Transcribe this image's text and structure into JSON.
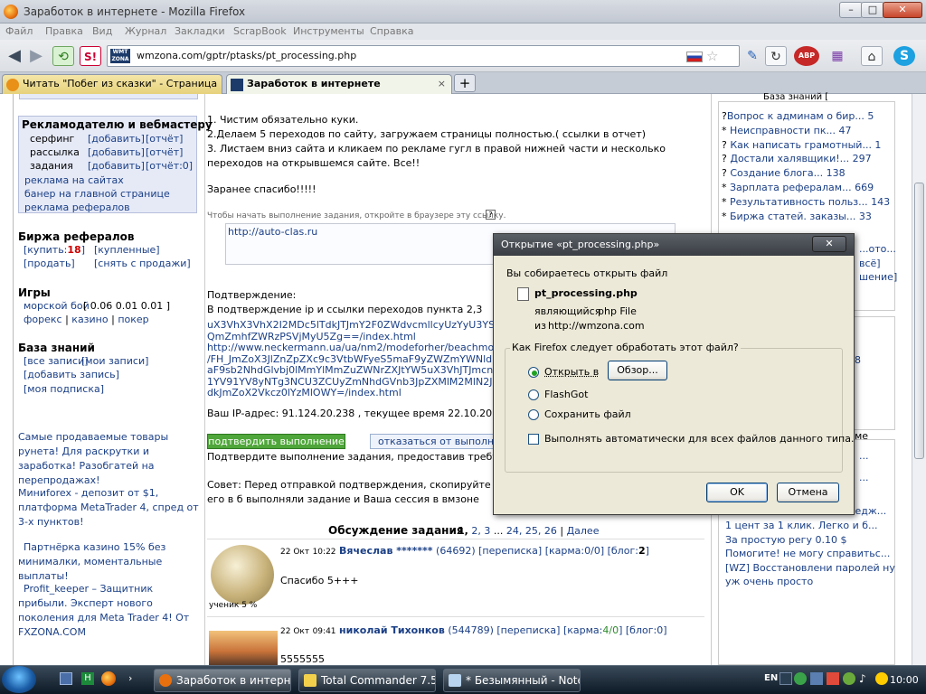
{
  "window": {
    "title": "Заработок в интернете - Mozilla Firefox",
    "minimize": "–",
    "maximize": "□",
    "close": "✕"
  },
  "menu": [
    "Файл",
    "Правка",
    "Вид",
    "Журнал",
    "Закладки",
    "ScrapBook",
    "Инструменты",
    "Справка"
  ],
  "url": "wmzona.com/gptr/ptasks/pt_processing.php",
  "tabs": [
    {
      "label": "Читать \"Побег из сказки\" - Страница 1...",
      "close": "×"
    },
    {
      "label": "Заработок в интернете",
      "close": "×"
    }
  ],
  "new_tab": "+",
  "left": {
    "ads_title": "Рекламодателю и вебмастеру",
    "rows": [
      {
        "name": "серфинг",
        "add": "[добавить]",
        "rep": "[отчёт]"
      },
      {
        "name": "рассылка",
        "add": "[добавить]",
        "rep": "[отчёт]"
      },
      {
        "name": "задания",
        "add": "[добавить]",
        "rep": "[отчёт:0]"
      }
    ],
    "links": [
      "реклама на сайтах",
      "банер на главной странице",
      "реклама рефералов"
    ],
    "exchange_title": "Биржа рефералов",
    "buy": "[купить:",
    "buy_count": "18",
    "buy_end": "]",
    "bought": "[купленные]",
    "sell": "[продать]",
    "withdraw": "[снять с продажи]",
    "games_title": "Игры",
    "sea_battle": "морской бой",
    "sea_prices": "[ 0.06 0.01 0.01 ]",
    "forex": "форекс",
    "casino": "казино",
    "poker": "покер",
    "sep": "|",
    "kb_title": "База знаний",
    "kb_all": "[все записи]",
    "kb_mine": "[мои записи]",
    "kb_add": "[добавить запись]",
    "kb_sub": "[моя подписка]",
    "promo1": "Самые продаваемые товары рунета! Для раскрутки и заработка! Разобгатей на перепродажах!",
    "promo2": "Миниforex - депозит от $1, платформа MetaTrader 4, спред от 3-х пунктов!",
    "promo3": "Партнёрка казино 15% без минималки, моментальные выплаты!",
    "promo4": "Profit_keeper – Защитник прибыли. Эксперт нового поколения для Meta Trader 4! От FXZONA.COM"
  },
  "main": {
    "steps": [
      "1. Чистим обязательно куки.",
      "2.Делаем 5 переходов по сайту, загружаем страницы полностью.( ссылки в отчет)",
      "3. Листаем вниз сайта и кликаем по рекламе гугл в правой нижней части и несколько переходов на открывшемся сайте. Все!!"
    ],
    "thanks": "Заранее спасибо!!!!!",
    "open_hint": "Чтобы начать выполнение задания, откройте в браузере эту ссылку.",
    "help": "?",
    "task_url": "http://auto-clas.ru",
    "confirm_label": "Подтверждение:",
    "confirm_text": "В подтверждение ip и ссылки переходов пункта 2,3",
    "report_lines": [
      "uX3VhX3VhX2I2MDc5lTdkJTJmY2F0ZWdvcmllcyUzYyU3YS5lY2tlcm",
      "QmZmhfZWRzPSVjMyU5Zg==/index.html",
      "http://www.neckermann.ua/ua/nm2/modeforher/beachmode",
      "/FH_JmZoX3JlZnZpZXc9c3VtbWFyeS5maF9yZWZmYWNldD1jYXRlZ",
      "aF9sb2NhdGlvbj0lMmYlMmZuZWNrZXJtYW5uX3VhJTJmcnVfVUElMmY",
      "1YV91YV8yNTg3NCU3ZCUyZmNhdGVnb3JpZXMlM2MlN2JuZWNrZXJtYW5",
      "dkJmZoX2Vkcz0lYzMlOWY=/index.html"
    ],
    "ip_text": "Ваш IP-адрес: 91.124.20.238 , текущее время 22.10.2011 10:5",
    "btn_confirm": "подтвердить выполнение",
    "btn_refuse": "отказаться от выполнен",
    "confirm_hint": "Подтвердите выполнение задания, предоставив требуемую",
    "advice": "Совет: Перед отправкой подтверждения, скопируйте его в б выполняли задание и Ваша сессия в вмзоне закончилась(необ",
    "discussion_title": "Обсуждение задания",
    "pages": [
      "1,",
      "2,",
      "3",
      "...",
      "24,",
      "25,",
      "26"
    ],
    "pages_sep": "|",
    "next": "Далее",
    "comments": [
      {
        "date": "22 Окт",
        "time": "10:22",
        "user": "Вячеслав *******",
        "uid": "(64692)",
        "pm": "[переписка]",
        "karma_pre": "[карма:",
        "karma": "0/0",
        "karma_post": "]",
        "blog_pre": "[блог:",
        "blog": "2",
        "blog_post": "]",
        "text": "Спасибо 5+++",
        "badge": "ученик 5 %"
      },
      {
        "date": "22 Окт",
        "time": "09:41",
        "user": "николай Тихонков",
        "uid": "(544789)",
        "pm": "[переписка]",
        "karma_pre": "[карма:",
        "karma": "4/0",
        "karma_post": "]",
        "blog_pre": "[блог:",
        "blog": "0",
        "blog_post": "]",
        "text": "5555555"
      }
    ]
  },
  "right": {
    "top": "База знаний [",
    "items": [
      "Вопрос к админам о бир... 5",
      "Неисправности пк... 47",
      "Как написать грамотный... 1",
      "Достали халявщики!... 297",
      "Создание блога... 138",
      "Зарплата рефералам... 669",
      "Результативность польз... 143",
      "Биржа статей. заказы... 33"
    ],
    "prefixes": [
      "?",
      "*",
      "?",
      "?",
      "?",
      "*",
      "*",
      "*"
    ],
    "frag1": "...ото...",
    "frag2": "всё]",
    "frag3": "шение]",
    "frag4": "8",
    "frag5": "ме",
    "frag6": "...",
    "frag7": "...",
    "frag8": "...едж...",
    "bottom": [
      "1 цент за 1 клик. Легко и б...",
      "За простую регу 0.10 $",
      "Помогите! не могу справитьс...",
      "[WZ] Восстановлени паролей ну уж очень просто"
    ]
  },
  "dialog": {
    "title": "Открытие «pt_processing.php»",
    "close": "✕",
    "intro": "Вы собираетесь открыть файл",
    "filename": "pt_processing.php",
    "type_label": "являющийся",
    "type": "php File",
    "from_label": "из",
    "from": "http://wmzona.com",
    "question": "Как Firefox следует обработать этот файл?",
    "open_with": "Открыть в",
    "browse": "Обзор...",
    "flashgot": "FlashGot",
    "save": "Сохранить файл",
    "auto": "Выполнять автоматически для всех файлов данного типа.",
    "ok": "OK",
    "cancel": "Отмена"
  },
  "taskbar": {
    "tasks": [
      "Заработок в интерне...",
      "Total Commander 7.5...",
      "* Безымянный - Note..."
    ],
    "lang": "EN",
    "clock": "10:00"
  }
}
